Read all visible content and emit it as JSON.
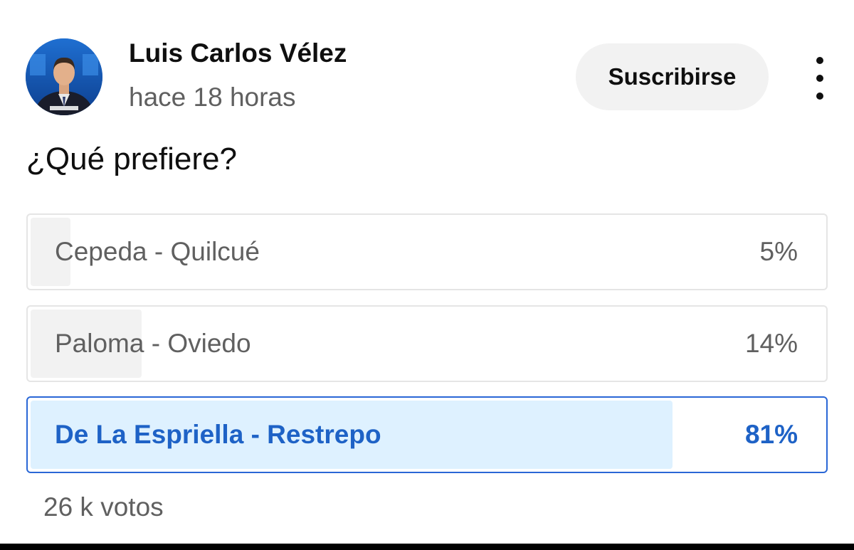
{
  "post": {
    "author_name": "Luis Carlos Vélez",
    "time": "hace 18 horas",
    "subscribe_label": "Suscribirse",
    "more_icon": "more-vert-icon"
  },
  "poll": {
    "question": "¿Qué prefiere?",
    "options": [
      {
        "label": "Cepeda - Quilcué",
        "percent_text": "5%",
        "percent": 5,
        "selected": false
      },
      {
        "label": "Paloma - Oviedo",
        "percent_text": "14%",
        "percent": 14,
        "selected": false
      },
      {
        "label": "De La Espriella - Restrepo",
        "percent_text": "81%",
        "percent": 81,
        "selected": true
      }
    ],
    "votes": "26 k votos"
  },
  "colors": {
    "selected_border": "#2a67d6",
    "selected_fill": "#def1ff",
    "selected_text": "#1e62c6",
    "unselected_fill": "#f2f2f2"
  }
}
